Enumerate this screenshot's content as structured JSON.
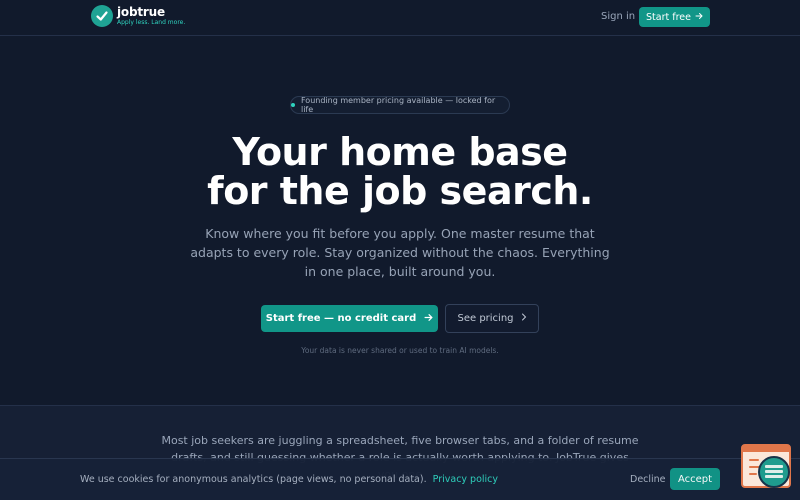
{
  "header": {
    "logo_name": "jobtrue",
    "logo_tagline": "Apply less. Land more.",
    "signin_label": "Sign in",
    "start_label": "Start free"
  },
  "hero": {
    "pill_text": "Founding member pricing available — locked for life",
    "headline_line1": "Your home base",
    "headline_line2": "for the job search.",
    "subtext": "Know where you fit before you apply. One master resume that adapts to every role. Stay organized without the chaos. Everything in one place, built around you.",
    "primary_cta": "Start free — no credit card",
    "secondary_cta": "See pricing",
    "privacy_note": "Your data is never shared or used to train AI models."
  },
  "section2": {
    "text": "Most job seekers are juggling a spreadsheet, five browser tabs, and a folder of resume drafts, and still guessing whether a role is actually worth applying to. JobTrue gives you one"
  },
  "cookie": {
    "text": "We use cookies for anonymous analytics (page views, no personal data).",
    "link": "Privacy policy",
    "decline": "Decline",
    "accept": "Accept"
  },
  "colors": {
    "background": "#111a2c",
    "accent": "#119688",
    "accent_text": "#2fd3bf"
  },
  "icons": {
    "logo": "check-circle-icon",
    "arrow": "arrow-right-icon",
    "chevron": "chevron-right-icon",
    "widget": "chat-widget-icon"
  }
}
